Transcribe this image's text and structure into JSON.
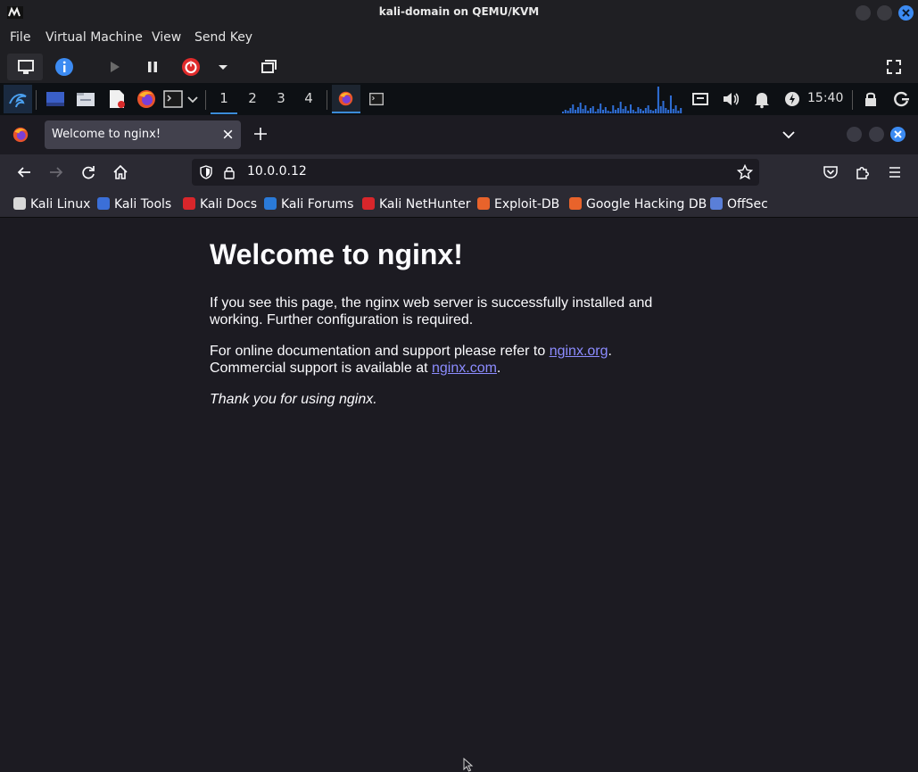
{
  "host": {
    "title": "kali-domain on QEMU/KVM",
    "menu": [
      "File",
      "Virtual Machine",
      "View",
      "Send Key"
    ]
  },
  "panel": {
    "workspaces": [
      "1",
      "2",
      "3",
      "4"
    ],
    "clock": "15:40",
    "cpu_graph": [
      2,
      4,
      3,
      6,
      10,
      4,
      7,
      12,
      5,
      9,
      3,
      6,
      8,
      2,
      5,
      11,
      4,
      7,
      3,
      2,
      9,
      4,
      6,
      13,
      5,
      8,
      3,
      10,
      4,
      2,
      7,
      5,
      3,
      6,
      9,
      4,
      3,
      5,
      30,
      8,
      14,
      6,
      4,
      20,
      5,
      9,
      3,
      6
    ]
  },
  "browser": {
    "tab_title": "Welcome to nginx!",
    "url": "10.0.0.12",
    "bookmarks": [
      {
        "label": "Kali Linux",
        "icon": "kali-dragon-icon",
        "color": "#d8d8d8"
      },
      {
        "label": "Kali Tools",
        "icon": "kali-tools-icon",
        "color": "#3b6fd8"
      },
      {
        "label": "Kali Docs",
        "icon": "kali-docs-icon",
        "color": "#d8262b"
      },
      {
        "label": "Kali Forums",
        "icon": "kali-forums-icon",
        "color": "#2a7ad8"
      },
      {
        "label": "Kali NetHunter",
        "icon": "nethunter-icon",
        "color": "#d8262b"
      },
      {
        "label": "Exploit-DB",
        "icon": "exploit-db-icon",
        "color": "#e8632b"
      },
      {
        "label": "Google Hacking DB",
        "icon": "ghdb-icon",
        "color": "#e8632b"
      },
      {
        "label": "OffSec",
        "icon": "offsec-icon",
        "color": "#5a7fd8"
      }
    ]
  },
  "page": {
    "heading": "Welcome to nginx!",
    "p1": "If you see this page, the nginx web server is successfully installed and working. Further configuration is required.",
    "p2_before": "For online documentation and support please refer to ",
    "link1": "nginx.org",
    "p2_mid": ".",
    "p2_line2": "Commercial support is available at ",
    "link2": "nginx.com",
    "p2_end": ".",
    "p3": "Thank you for using nginx."
  },
  "colors": {
    "accent": "#3c8bf2",
    "link": "#8c8cff",
    "page_bg": "#1c1b22"
  }
}
